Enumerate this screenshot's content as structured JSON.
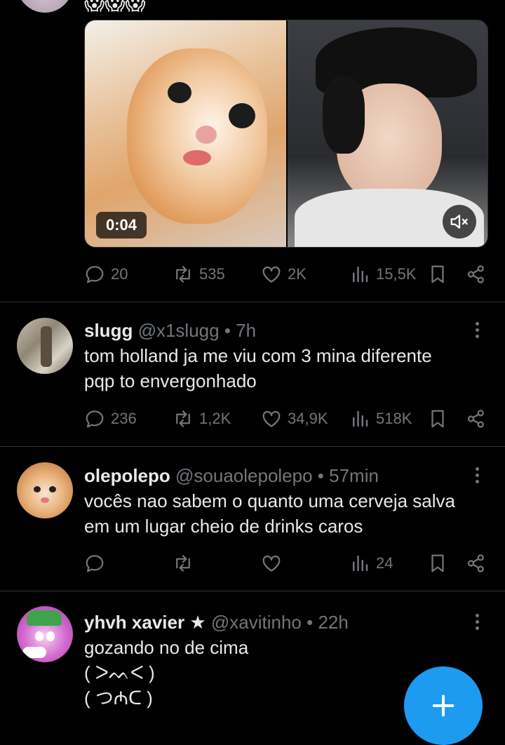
{
  "top_post": {
    "emoji": "😱😱😱",
    "video": {
      "duration": "0:04"
    },
    "actions": {
      "replies": "20",
      "reposts": "535",
      "likes": "2K",
      "views": "15,5K"
    }
  },
  "posts": [
    {
      "display_name": "slugg",
      "handle": "@x1slugg",
      "time": "7h",
      "text": "tom holland ja me viu com 3 mina diferente\npqp to envergonhado",
      "actions": {
        "replies": "236",
        "reposts": "1,2K",
        "likes": "34,9K",
        "views": "518K"
      }
    },
    {
      "display_name": "olepolepo",
      "handle": "@souaolepolepo",
      "time": "57min",
      "text": "vocês nao sabem o quanto uma cerveja salva\nem um lugar cheio de drinks caros",
      "actions": {
        "replies": "",
        "reposts": "",
        "likes": "",
        "views": "24"
      }
    },
    {
      "display_name": "yhvh xavier ★",
      "handle": "@xavitinho",
      "time": "22h",
      "text": "gozando no de cima\n( ᐳᨓᐸ )\n( つ₼ᑕ )"
    }
  ],
  "sep": " • ",
  "icons": [
    "reply-icon",
    "repost-icon",
    "like-icon",
    "views-icon",
    "bookmark-icon",
    "share-icon",
    "more-icon",
    "mute-icon",
    "compose-icon"
  ],
  "colors": {
    "background": "#000000",
    "text": "#e7e9ea",
    "muted": "#71767b",
    "accent": "#1d9bf0",
    "divider": "#2f3336"
  }
}
